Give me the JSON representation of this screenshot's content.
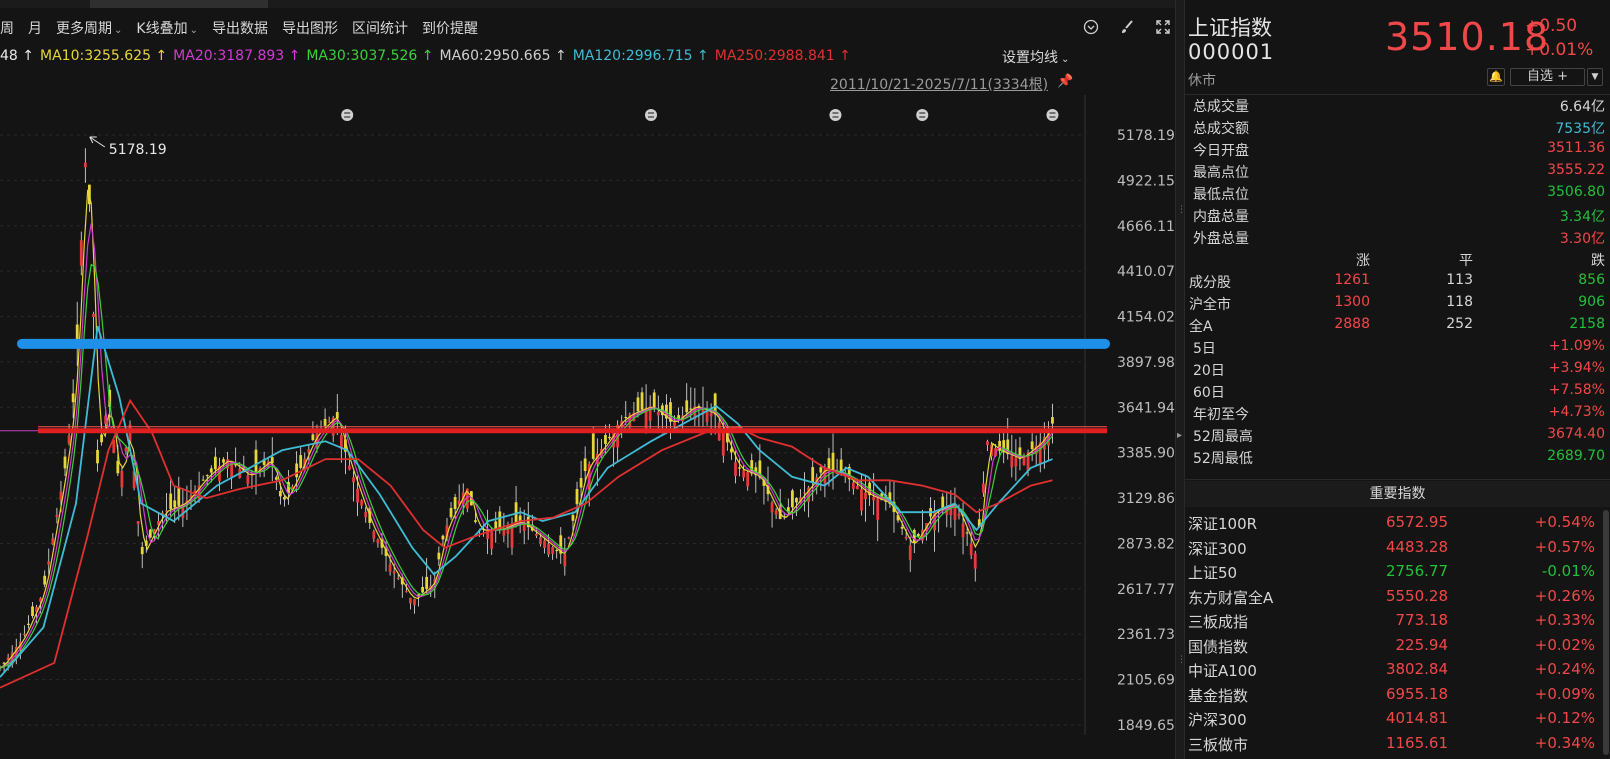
{
  "toolbar": {
    "items": [
      {
        "label": "周",
        "caret": false
      },
      {
        "label": "月",
        "caret": false
      },
      {
        "label": "更多周期",
        "caret": true
      },
      {
        "label": "K线叠加",
        "caret": true
      },
      {
        "label": "导出数据",
        "caret": false
      },
      {
        "label": "导出图形",
        "caret": false
      },
      {
        "label": "区间统计",
        "caret": false
      },
      {
        "label": "到价提醒",
        "caret": false
      }
    ],
    "icons": [
      "chevron-circle-icon",
      "brush-icon",
      "fullscreen-icon"
    ]
  },
  "ma_legend": [
    {
      "text": "48 ↑",
      "color": "#e8e8e8"
    },
    {
      "text": "MA10:3255.625 ↑",
      "color": "#e6d63a"
    },
    {
      "text": "MA20:3187.893 ↑",
      "color": "#d23ad2"
    },
    {
      "text": "MA30:3037.526 ↑",
      "color": "#3ad23a"
    },
    {
      "text": "MA60:2950.665 ↑",
      "color": "#cfcfcf"
    },
    {
      "text": "MA120:2996.715 ↑",
      "color": "#3fbcd6"
    },
    {
      "text": "MA250:2988.841 ↑",
      "color": "#e03030"
    }
  ],
  "set_ma_label": "设置均线",
  "range_label": "2011/10/21-2025/7/11(3334根)",
  "chart_data": {
    "type": "candlestick",
    "y_ticks": [
      "5178.19",
      "4922.15",
      "4666.11",
      "4410.07",
      "4154.02",
      "3897.98",
      "3641.94",
      "3385.90",
      "3129.86",
      "2873.82",
      "2617.77",
      "2361.73",
      "2105.69",
      "1849.65"
    ],
    "ylim": [
      1849.65,
      5178.19
    ],
    "peak_label": "5178.19",
    "horizontal_lines": [
      {
        "value": 4000,
        "color": "#1e90e8"
      },
      {
        "value": 3510,
        "color": "#e02020"
      }
    ],
    "close_path": [
      [
        0,
        2170
      ],
      [
        2,
        2330
      ],
      [
        4,
        2600
      ],
      [
        6,
        3300
      ],
      [
        7,
        3800
      ],
      [
        7.5,
        4600
      ],
      [
        8,
        5178
      ],
      [
        8.6,
        4200
      ],
      [
        9,
        3300
      ],
      [
        10,
        3700
      ],
      [
        11,
        3200
      ],
      [
        12,
        3550
      ],
      [
        13,
        2800
      ],
      [
        15,
        3050
      ],
      [
        17,
        3100
      ],
      [
        19,
        3250
      ],
      [
        21,
        3350
      ],
      [
        23,
        3250
      ],
      [
        25,
        3350
      ],
      [
        26,
        3100
      ],
      [
        27,
        3200
      ],
      [
        29,
        3480
      ],
      [
        31,
        3600
      ],
      [
        32,
        3350
      ],
      [
        34,
        3000
      ],
      [
        36,
        2750
      ],
      [
        38,
        2550
      ],
      [
        40,
        2650
      ],
      [
        41,
        2950
      ],
      [
        43,
        3200
      ],
      [
        44,
        2950
      ],
      [
        46,
        2950
      ],
      [
        48,
        3000
      ],
      [
        50,
        2900
      ],
      [
        52,
        2800
      ],
      [
        54,
        3300
      ],
      [
        56,
        3450
      ],
      [
        57,
        3550
      ],
      [
        58,
        3600
      ],
      [
        60,
        3650
      ],
      [
        62,
        3550
      ],
      [
        64,
        3650
      ],
      [
        66,
        3600
      ],
      [
        68,
        3300
      ],
      [
        70,
        3250
      ],
      [
        72,
        3000
      ],
      [
        74,
        3150
      ],
      [
        76,
        3300
      ],
      [
        78,
        3250
      ],
      [
        80,
        3150
      ],
      [
        82,
        3100
      ],
      [
        84,
        2850
      ],
      [
        86,
        3050
      ],
      [
        88,
        3100
      ],
      [
        90,
        2800
      ],
      [
        91,
        3450
      ],
      [
        92,
        3400
      ],
      [
        94,
        3350
      ],
      [
        96,
        3450
      ],
      [
        97,
        3550
      ]
    ],
    "ma_paths": [
      {
        "name": "MA120",
        "color": "#3fbcd6",
        "points": [
          [
            0,
            2120
          ],
          [
            4,
            2400
          ],
          [
            7,
            3100
          ],
          [
            9,
            4100
          ],
          [
            11,
            3700
          ],
          [
            13,
            3100
          ],
          [
            16,
            3000
          ],
          [
            20,
            3200
          ],
          [
            23,
            3300
          ],
          [
            26,
            3400
          ],
          [
            30,
            3450
          ],
          [
            32,
            3400
          ],
          [
            35,
            3150
          ],
          [
            38,
            2850
          ],
          [
            40,
            2700
          ],
          [
            42,
            2800
          ],
          [
            45,
            3000
          ],
          [
            48,
            3050
          ],
          [
            50,
            3000
          ],
          [
            53,
            3050
          ],
          [
            56,
            3300
          ],
          [
            60,
            3450
          ],
          [
            63,
            3550
          ],
          [
            66,
            3650
          ],
          [
            68,
            3550
          ],
          [
            70,
            3400
          ],
          [
            73,
            3250
          ],
          [
            76,
            3200
          ],
          [
            78,
            3300
          ],
          [
            80,
            3250
          ],
          [
            83,
            3050
          ],
          [
            86,
            3050
          ],
          [
            88,
            3100
          ],
          [
            90,
            2950
          ],
          [
            92,
            3100
          ],
          [
            95,
            3300
          ],
          [
            97,
            3350
          ]
        ]
      },
      {
        "name": "MA250",
        "color": "#e03030",
        "points": [
          [
            0,
            2060
          ],
          [
            5,
            2200
          ],
          [
            8,
            2900
          ],
          [
            10,
            3400
          ],
          [
            12,
            3680
          ],
          [
            14,
            3500
          ],
          [
            16,
            3200
          ],
          [
            19,
            3130
          ],
          [
            22,
            3180
          ],
          [
            26,
            3230
          ],
          [
            30,
            3350
          ],
          [
            33,
            3350
          ],
          [
            36,
            3200
          ],
          [
            39,
            2950
          ],
          [
            41,
            2850
          ],
          [
            44,
            2920
          ],
          [
            48,
            3000
          ],
          [
            51,
            3020
          ],
          [
            54,
            3100
          ],
          [
            57,
            3250
          ],
          [
            61,
            3400
          ],
          [
            65,
            3500
          ],
          [
            68,
            3530
          ],
          [
            70,
            3470
          ],
          [
            73,
            3420
          ],
          [
            76,
            3300
          ],
          [
            79,
            3230
          ],
          [
            82,
            3230
          ],
          [
            85,
            3200
          ],
          [
            88,
            3150
          ],
          [
            90,
            3050
          ],
          [
            92,
            3100
          ],
          [
            95,
            3200
          ],
          [
            97,
            3230
          ]
        ]
      }
    ],
    "events": [
      32,
      60,
      77,
      85,
      97
    ],
    "vol_bars": "decorative"
  },
  "quote": {
    "name": "上证指数",
    "code": "000001",
    "status": "休市",
    "price": "3510.18",
    "change": "+0.50",
    "change_pct": "+0.01%",
    "watch_label": "自选 +"
  },
  "stats": [
    {
      "label": "总成交量",
      "value": "6.64亿",
      "color": "white"
    },
    {
      "label": "总成交额",
      "value": "7535亿",
      "color": "cyan"
    },
    {
      "label": "今日开盘",
      "value": "3511.36",
      "color": "red"
    },
    {
      "label": "最高点位",
      "value": "3555.22",
      "color": "red"
    },
    {
      "label": "最低点位",
      "value": "3506.80",
      "color": "green"
    },
    {
      "label": "内盘总量",
      "value": "3.34亿",
      "color": "green"
    },
    {
      "label": "外盘总量",
      "value": "3.30亿",
      "color": "red"
    }
  ],
  "breadth": {
    "headers": [
      "涨",
      "平",
      "跌"
    ],
    "rows": [
      {
        "label": "成分股",
        "up": "1261",
        "flat": "113",
        "down": "856"
      },
      {
        "label": "沪全市",
        "up": "1300",
        "flat": "118",
        "down": "906"
      },
      {
        "label": "全A",
        "up": "2888",
        "flat": "252",
        "down": "2158"
      }
    ]
  },
  "periods": [
    {
      "label": "5日",
      "value": "+1.09%",
      "color": "red"
    },
    {
      "label": "20日",
      "value": "+3.94%",
      "color": "red"
    },
    {
      "label": "60日",
      "value": "+7.58%",
      "color": "red"
    },
    {
      "label": "年初至今",
      "value": "+4.73%",
      "color": "red"
    },
    {
      "label": "52周最高",
      "value": "3674.40",
      "color": "red"
    },
    {
      "label": "52周最低",
      "value": "2689.70",
      "color": "green"
    }
  ],
  "important_title": "重要指数",
  "indices": [
    {
      "name": "深证100R",
      "price": "6572.95",
      "chg": "+0.54%",
      "color": "red"
    },
    {
      "name": "深证300",
      "price": "4483.28",
      "chg": "+0.57%",
      "color": "red"
    },
    {
      "name": "上证50",
      "price": "2756.77",
      "chg": "-0.01%",
      "color": "green"
    },
    {
      "name": "东方财富全A",
      "price": "5550.28",
      "chg": "+0.26%",
      "color": "red"
    },
    {
      "name": "三板成指",
      "price": "773.18",
      "chg": "+0.33%",
      "color": "red"
    },
    {
      "name": "国债指数",
      "price": "225.94",
      "chg": "+0.02%",
      "color": "red"
    },
    {
      "name": "中证A100",
      "price": "3802.84",
      "chg": "+0.24%",
      "color": "red"
    },
    {
      "name": "基金指数",
      "price": "6955.18",
      "chg": "+0.09%",
      "color": "red"
    },
    {
      "name": "沪深300",
      "price": "4014.81",
      "chg": "+0.12%",
      "color": "red"
    },
    {
      "name": "三板做市",
      "price": "1165.61",
      "chg": "+0.34%",
      "color": "red"
    }
  ]
}
